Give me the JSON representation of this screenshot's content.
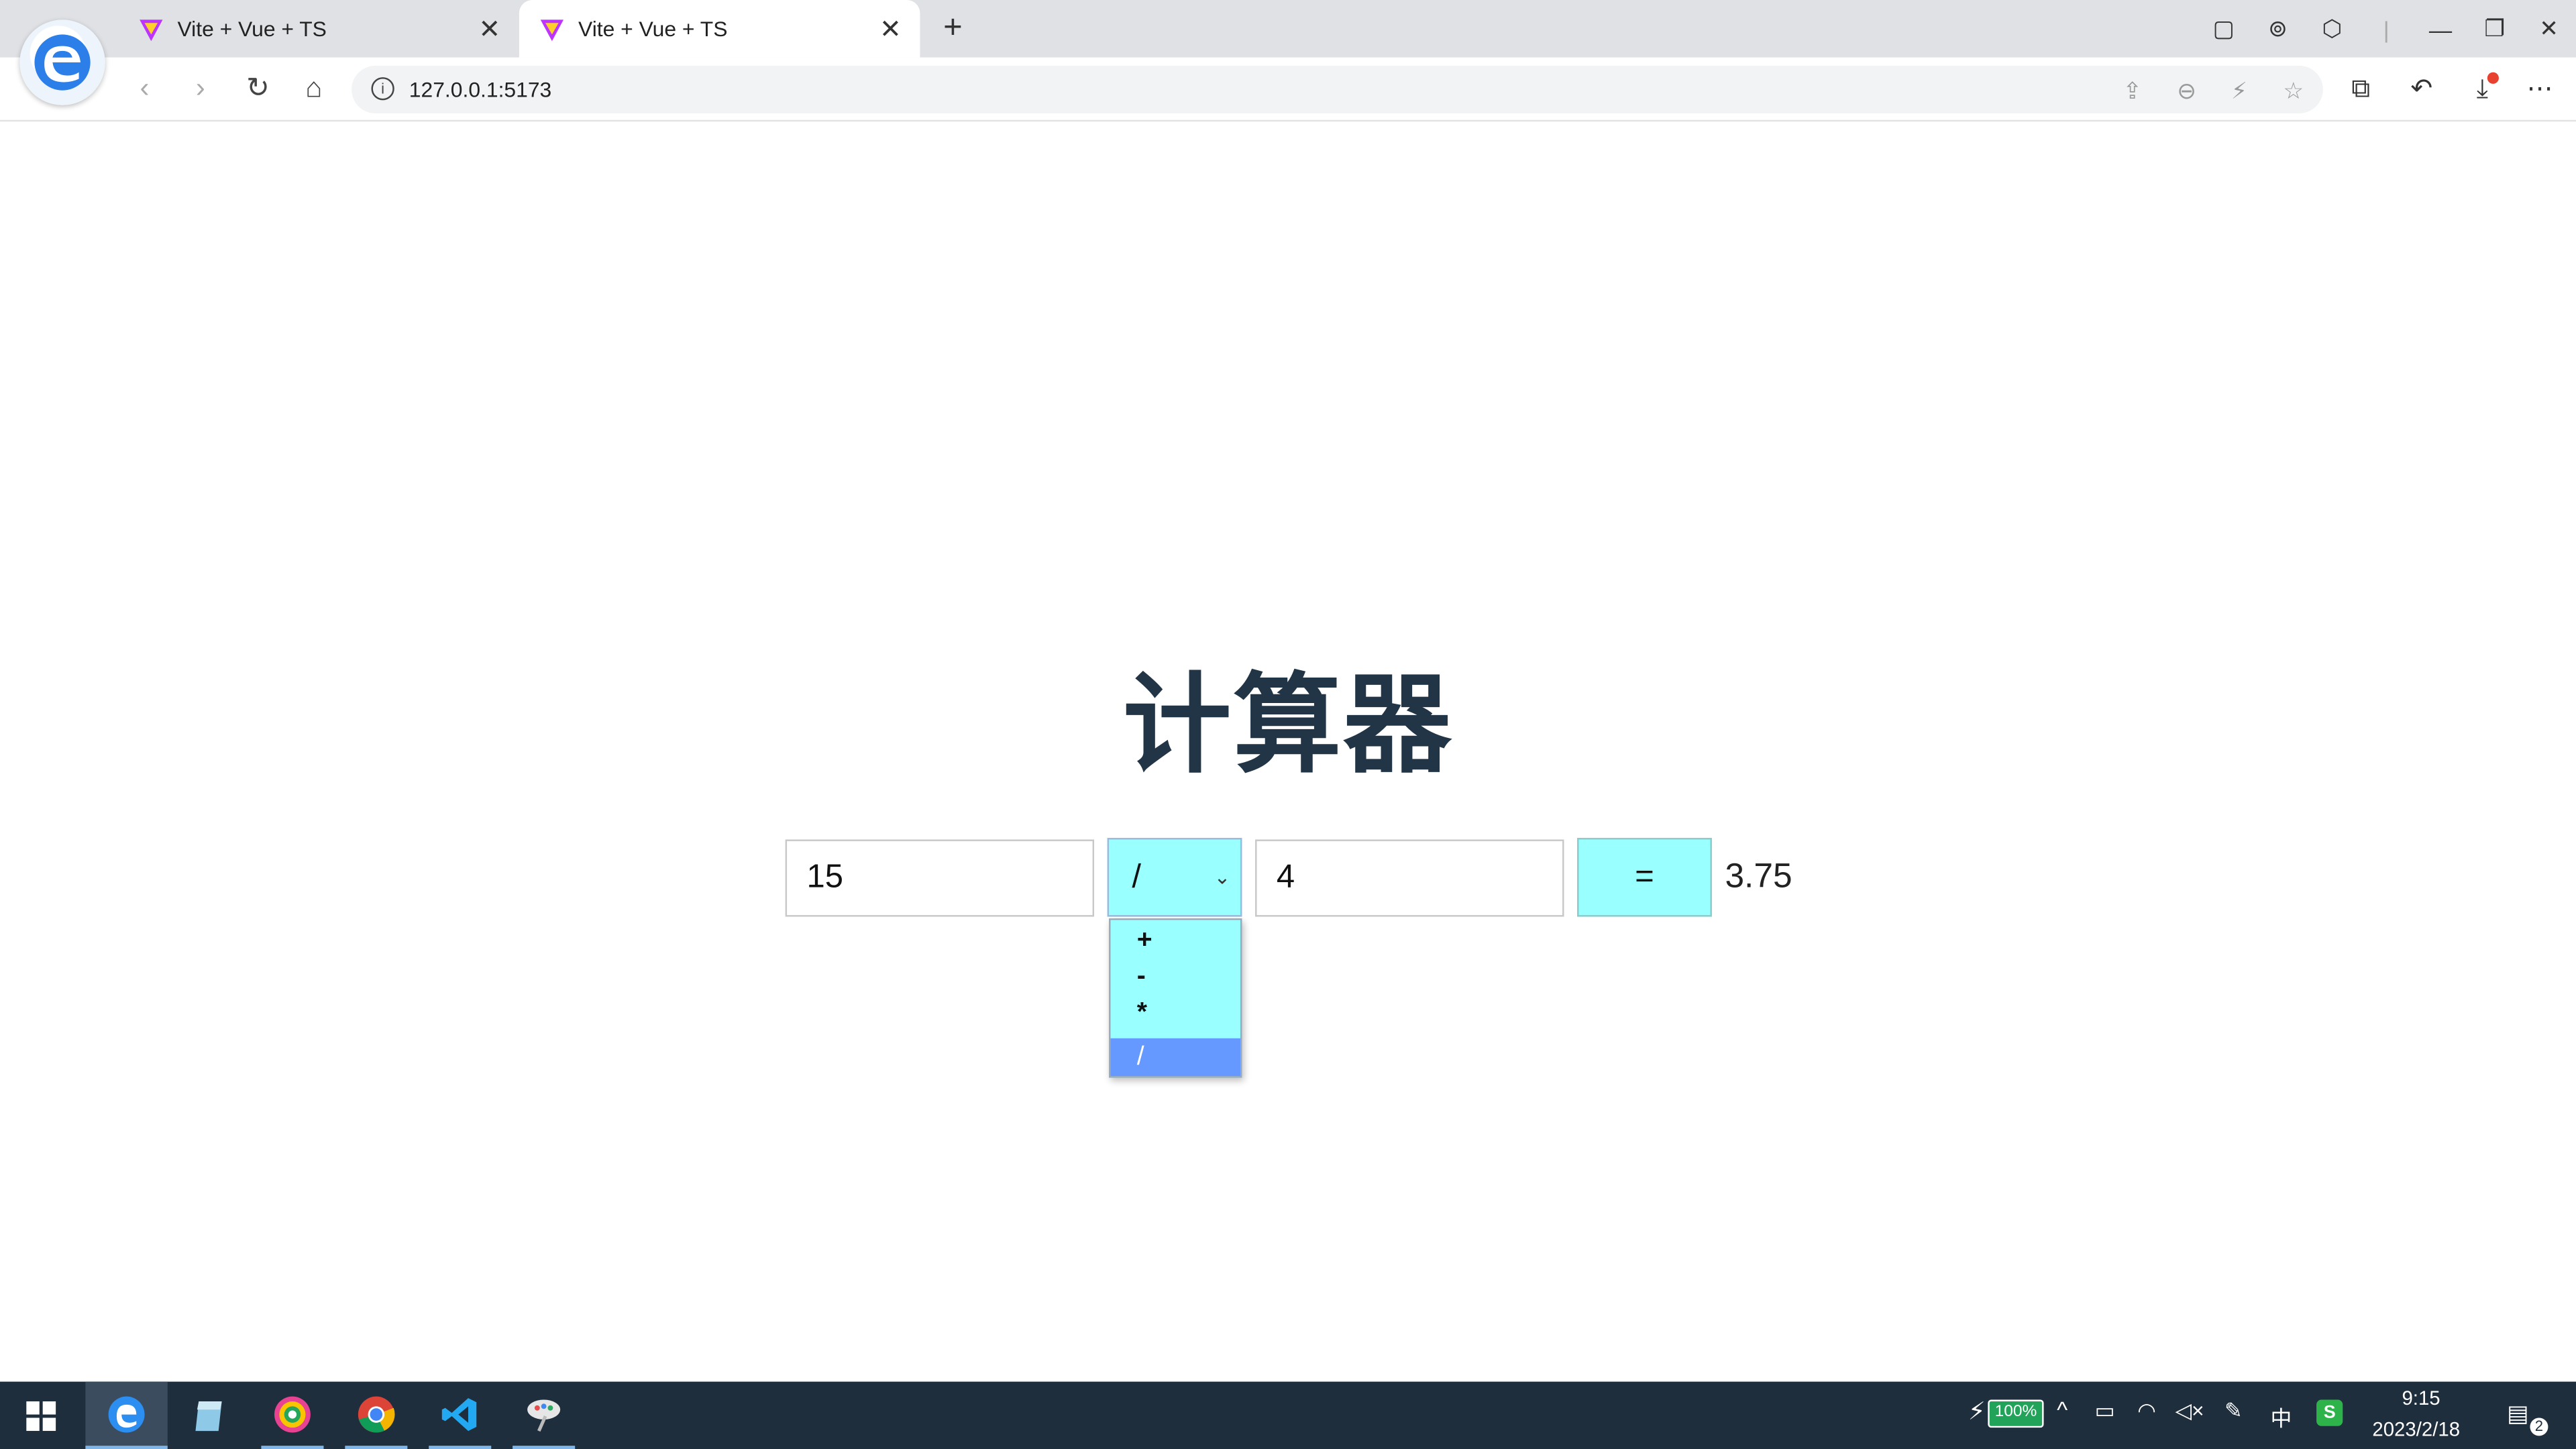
{
  "browser": {
    "tabs": [
      {
        "title": "Vite + Vue + TS",
        "active": false
      },
      {
        "title": "Vite + Vue + TS",
        "active": true
      }
    ],
    "url": "127.0.0.1:5173",
    "icons": [
      "back-icon",
      "forward-icon",
      "reload-icon",
      "home-icon",
      "site-info-icon",
      "share-icon",
      "zoom-icon",
      "bolt-icon",
      "star-icon",
      "extensions-icon",
      "undo-icon",
      "download-icon",
      "more-icon"
    ]
  },
  "calculator": {
    "title": "计算器",
    "num1": "15",
    "operator": "/",
    "num2": "4",
    "equals_label": "=",
    "result": "3.75",
    "operator_options": [
      "+",
      "-",
      "*",
      "/"
    ],
    "selected_option": "/"
  },
  "taskbar": {
    "apps": [
      "start-icon",
      "edge-browser-icon",
      "notes-app-icon",
      "color-app-icon",
      "chrome-icon",
      "vscode-icon",
      "paint-app-icon"
    ],
    "battery": "100%",
    "ime": "中",
    "time": "9:15",
    "date": "2023/2/18",
    "notifications": "2"
  },
  "colors": {
    "accent_cyan": "#99ffff",
    "selected_option": "#6699ff",
    "title": "#213547",
    "taskbar": "#1f2e3d"
  }
}
